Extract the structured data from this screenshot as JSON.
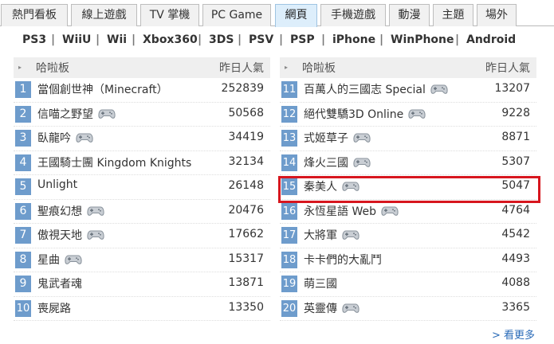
{
  "tabs": [
    {
      "label": "熱門看板"
    },
    {
      "label": "線上遊戲"
    },
    {
      "label": "TV 掌機"
    },
    {
      "label": "PC Game"
    },
    {
      "label": "網頁"
    },
    {
      "label": "手機遊戲"
    },
    {
      "label": "動漫"
    },
    {
      "label": "主題"
    },
    {
      "label": "場外"
    }
  ],
  "active_tab": "網頁",
  "platforms": [
    "PS3",
    "WiiU",
    "Wii",
    "Xbox360",
    "3DS",
    "PSV",
    "PSP",
    "iPhone",
    "WinPhone",
    "Android"
  ],
  "platform_separator": "|",
  "left_header": {
    "name": "哈啦板",
    "popularity": "昨日人氣"
  },
  "right_header": {
    "name": "哈啦板",
    "popularity": "昨日人氣"
  },
  "left_rows": [
    {
      "rank": "1",
      "title": "當個創世神（Minecraft）",
      "popularity": "252839",
      "gamepad": false
    },
    {
      "rank": "2",
      "title": "信喵之野望",
      "popularity": "50568",
      "gamepad": true
    },
    {
      "rank": "3",
      "title": "臥龍吟",
      "popularity": "34419",
      "gamepad": true
    },
    {
      "rank": "4",
      "title": "王國騎士團 Kingdom Knights",
      "popularity": "32134",
      "gamepad": false
    },
    {
      "rank": "5",
      "title": "Unlight",
      "popularity": "26148",
      "gamepad": false
    },
    {
      "rank": "6",
      "title": "聖痕幻想",
      "popularity": "20476",
      "gamepad": true
    },
    {
      "rank": "7",
      "title": "傲視天地",
      "popularity": "17662",
      "gamepad": true
    },
    {
      "rank": "8",
      "title": "星曲",
      "popularity": "15317",
      "gamepad": true
    },
    {
      "rank": "9",
      "title": "鬼武者魂",
      "popularity": "13871",
      "gamepad": false
    },
    {
      "rank": "10",
      "title": "喪屍路",
      "popularity": "13350",
      "gamepad": false
    }
  ],
  "right_rows": [
    {
      "rank": "11",
      "title": "百萬人的三國志 Special",
      "popularity": "13207",
      "gamepad": true
    },
    {
      "rank": "12",
      "title": "絕代雙驕3D Online",
      "popularity": "9228",
      "gamepad": true
    },
    {
      "rank": "13",
      "title": "式姬草子",
      "popularity": "8871",
      "gamepad": true
    },
    {
      "rank": "14",
      "title": "烽火三國",
      "popularity": "5307",
      "gamepad": true
    },
    {
      "rank": "15",
      "title": "秦美人",
      "popularity": "5047",
      "gamepad": true
    },
    {
      "rank": "16",
      "title": "永恆星語 Web",
      "popularity": "4764",
      "gamepad": true
    },
    {
      "rank": "17",
      "title": "大將軍",
      "popularity": "4542",
      "gamepad": true
    },
    {
      "rank": "18",
      "title": "卡卡們的大亂鬥",
      "popularity": "4493",
      "gamepad": false
    },
    {
      "rank": "19",
      "title": "萌三國",
      "popularity": "4088",
      "gamepad": false
    },
    {
      "rank": "20",
      "title": "英靈傳",
      "popularity": "3365",
      "gamepad": true
    }
  ],
  "highlighted_rank": "15",
  "highlight_color": "#d7161e",
  "rank_badge_color": "#6e9ccc",
  "more_link": "> 看更多",
  "icons": {
    "header_bullet": "bullet-icon",
    "row_badge": "gamepad-icon"
  }
}
